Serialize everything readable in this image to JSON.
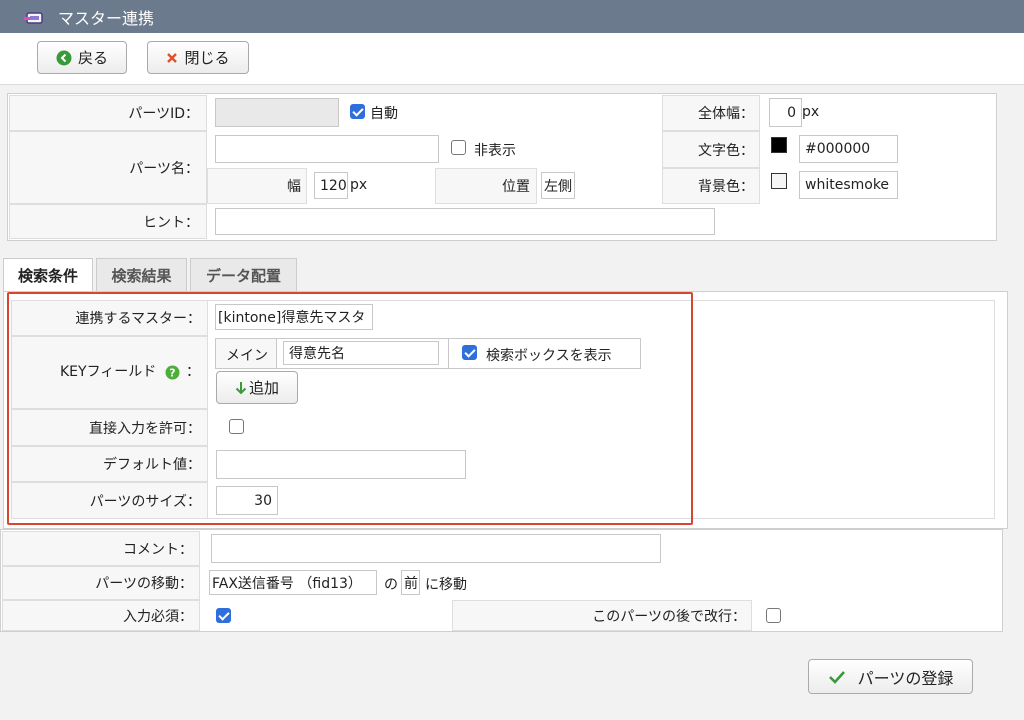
{
  "titlebar": {
    "title": "マスター連携"
  },
  "toolbar": {
    "back_label": "戻る",
    "close_label": "閉じる"
  },
  "basic": {
    "parts_id_label": "パーツID：",
    "auto_label": "自動",
    "auto_checked": true,
    "parts_name_label": "パーツ名：",
    "hidden_label": "非表示",
    "width_label": "幅",
    "width_value": "120",
    "width_unit": "px",
    "position_label": "位置",
    "position_value": "左側",
    "hint_label": "ヒント：",
    "total_width_label": "全体幅：",
    "total_width_value": "0",
    "total_width_unit": "px",
    "text_color_label": "文字色：",
    "text_color_value": "#000000",
    "bg_color_label": "背景色：",
    "bg_color_value": "whitesmoke"
  },
  "tabs": [
    {
      "label": "検索条件",
      "active": true
    },
    {
      "label": "検索結果",
      "active": false
    },
    {
      "label": "データ配置",
      "active": false
    }
  ],
  "search": {
    "master_label": "連携するマスター：",
    "master_value": "[kintone]得意先マスタ",
    "key_label": "KEYフィールド",
    "key_colon": "：",
    "key_main": "メイン",
    "key_field_value": "得意先名",
    "show_searchbox_label": "検索ボックスを表示",
    "add_label": "追加",
    "direct_input_label": "直接入力を許可：",
    "default_label": "デフォルト値：",
    "size_label": "パーツのサイズ：",
    "size_value": "30"
  },
  "bottom": {
    "comment_label": "コメント：",
    "move_label": "パーツの移動：",
    "move_field": "FAX送信番号 （fid13）",
    "move_no": "の",
    "move_position": "前",
    "move_suffix": "に移動",
    "required_label": "入力必須：",
    "linebreak_label": "このパーツの後で改行："
  },
  "register": {
    "label": "パーツの登録"
  },
  "colors": {
    "title_bg": "#6b7a8c",
    "accent_red": "#d8462f",
    "check_blue": "#2f6fdb"
  }
}
